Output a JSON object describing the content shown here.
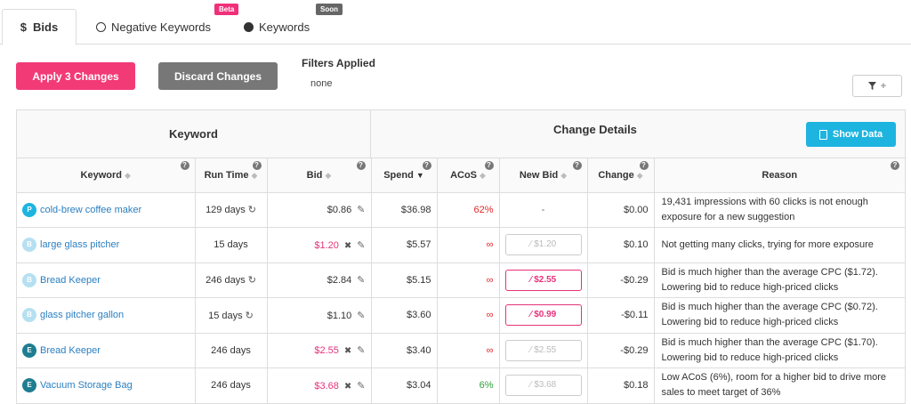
{
  "tabs": {
    "bids_label": "Bids",
    "bids_icon": "$",
    "negative_label": "Negative Keywords",
    "negative_badge": "Beta",
    "keywords_label": "Keywords",
    "keywords_badge": "Soon"
  },
  "toolbar": {
    "apply_label": "Apply 3 Changes",
    "discard_label": "Discard Changes",
    "filters_title": "Filters Applied",
    "filters_value": "none",
    "filter_icon": "filter-icon",
    "filter_plus": "+"
  },
  "table": {
    "group_keyword": "Keyword",
    "group_change_details": "Change Details",
    "show_data_label": "Show Data",
    "columns": {
      "keyword": "Keyword",
      "run_time": "Run Time",
      "bid": "Bid",
      "spend": "Spend",
      "acos": "ACoS",
      "new_bid": "New Bid",
      "change": "Change",
      "reason": "Reason"
    },
    "rows": [
      {
        "avatar": "P",
        "keyword": "cold-brew coffee maker",
        "run_time": "129 days",
        "refresh": true,
        "bid": "$0.86",
        "bid_changed": false,
        "spend": "$36.98",
        "acos": "62%",
        "acos_color": "red",
        "new_bid": "-",
        "new_bid_state": "none",
        "change": "$0.00",
        "reason": "19,431 impressions with 60 clicks is not enough exposure for a new suggestion"
      },
      {
        "avatar": "B",
        "keyword": "large glass pitcher",
        "run_time": "15 days",
        "refresh": false,
        "bid": "$1.20",
        "bid_changed": true,
        "spend": "$5.57",
        "acos": "∞",
        "acos_color": "red",
        "new_bid": "$1.20",
        "new_bid_state": "disabled",
        "change": "$0.10",
        "reason": "Not getting many clicks, trying for more exposure"
      },
      {
        "avatar": "B",
        "keyword": "Bread Keeper",
        "run_time": "246 days",
        "refresh": true,
        "bid": "$2.84",
        "bid_changed": false,
        "spend": "$5.15",
        "acos": "∞",
        "acos_color": "red",
        "new_bid": "$2.55",
        "new_bid_state": "active",
        "change": "-$0.29",
        "reason": "Bid is much higher than the average CPC ($1.72). Lowering bid to reduce high-priced clicks"
      },
      {
        "avatar": "B",
        "keyword": "glass pitcher gallon",
        "run_time": "15 days",
        "refresh": true,
        "bid": "$1.10",
        "bid_changed": false,
        "spend": "$3.60",
        "acos": "∞",
        "acos_color": "red",
        "new_bid": "$0.99",
        "new_bid_state": "active",
        "change": "-$0.11",
        "reason": "Bid is much higher than the average CPC ($0.72). Lowering bid to reduce high-priced clicks"
      },
      {
        "avatar": "E",
        "keyword": "Bread Keeper",
        "run_time": "246 days",
        "refresh": false,
        "bid": "$2.55",
        "bid_changed": true,
        "spend": "$3.40",
        "acos": "∞",
        "acos_color": "red",
        "new_bid": "$2.55",
        "new_bid_state": "disabled",
        "change": "-$0.29",
        "reason": "Bid is much higher than the average CPC ($1.70). Lowering bid to reduce high-priced clicks"
      },
      {
        "avatar": "E",
        "keyword": "Vacuum Storage Bag",
        "run_time": "246 days",
        "refresh": false,
        "bid": "$3.68",
        "bid_changed": true,
        "spend": "$3.04",
        "acos": "6%",
        "acos_color": "green",
        "new_bid": "$3.68",
        "new_bid_state": "disabled",
        "change": "$0.18",
        "reason": "Low ACoS (6%), room for a higher bid to drive more sales to meet target of 36%"
      }
    ]
  },
  "colors": {
    "accent_pink": "#f23a77",
    "accent_blue": "#1eb4e0",
    "link_blue": "#2a7fc1"
  }
}
